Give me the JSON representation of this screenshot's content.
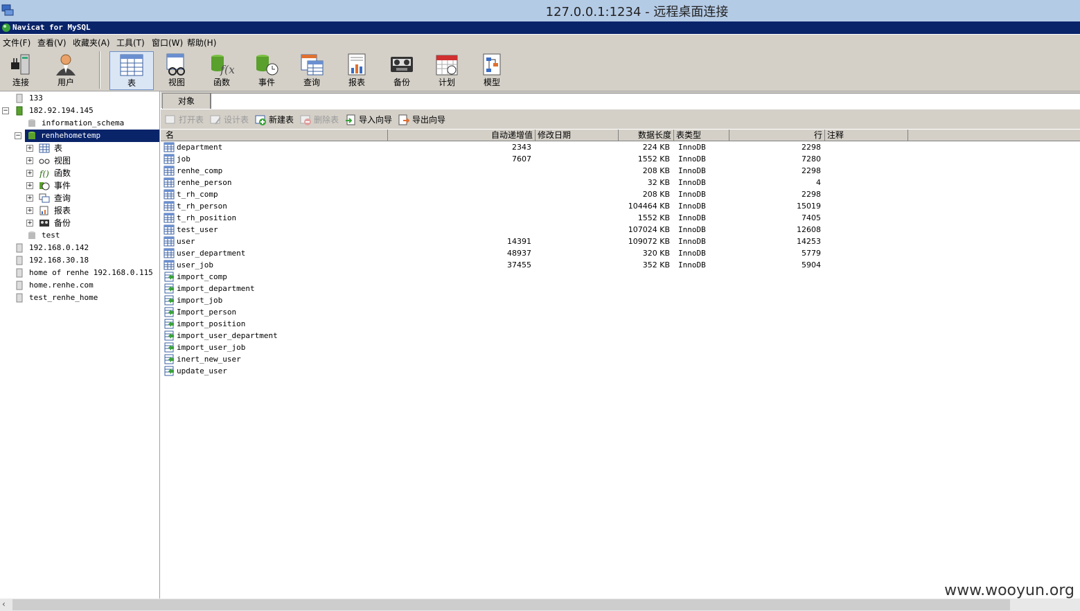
{
  "rdp": {
    "title": "127.0.0.1:1234 - 远程桌面连接"
  },
  "app": {
    "title": "Navicat for MySQL"
  },
  "menu": [
    "文件(F)",
    "查看(V)",
    "收藏夹(A)",
    "工具(T)",
    "窗口(W)",
    "帮助(H)"
  ],
  "toolbar": [
    {
      "label": "连接",
      "icon": "connection-plug-icon"
    },
    {
      "label": "用户",
      "icon": "user-icon"
    },
    {
      "label": "表",
      "icon": "table-icon",
      "active": true
    },
    {
      "label": "视图",
      "icon": "view-icon"
    },
    {
      "label": "函数",
      "icon": "function-icon"
    },
    {
      "label": "事件",
      "icon": "event-icon"
    },
    {
      "label": "查询",
      "icon": "query-icon"
    },
    {
      "label": "报表",
      "icon": "report-icon"
    },
    {
      "label": "备份",
      "icon": "backup-icon"
    },
    {
      "label": "计划",
      "icon": "schedule-icon"
    },
    {
      "label": "模型",
      "icon": "model-icon"
    }
  ],
  "tree": [
    {
      "label": "133"
    },
    {
      "label": "182.92.194.145"
    },
    {
      "label": "information_schema"
    },
    {
      "label": "renhehometemp"
    },
    {
      "label": "表"
    },
    {
      "label": "视图"
    },
    {
      "label": "函数"
    },
    {
      "label": "事件"
    },
    {
      "label": "查询"
    },
    {
      "label": "报表"
    },
    {
      "label": "备份"
    },
    {
      "label": "test"
    },
    {
      "label": "192.168.0.142"
    },
    {
      "label": "192.168.30.18"
    },
    {
      "label": "home of renhe 192.168.0.115"
    },
    {
      "label": "home.renhe.com"
    },
    {
      "label": "test_renhe_home"
    }
  ],
  "tabs": {
    "objects": "对象"
  },
  "obj_toolbar": {
    "open": "打开表",
    "design": "设计表",
    "new": "新建表",
    "delete": "删除表",
    "import": "导入向导",
    "export": "导出向导"
  },
  "columns": {
    "name": "名",
    "auto_inc": "自动递增值",
    "modified": "修改日期",
    "data_len": "数据长度",
    "type": "表类型",
    "rows": "行",
    "comment": "注释"
  },
  "tables": [
    {
      "name": "department",
      "auto_inc": "2343",
      "data_len": "224 KB",
      "type": "InnoDB",
      "rows": "2298"
    },
    {
      "name": "job",
      "auto_inc": "7607",
      "data_len": "1552 KB",
      "type": "InnoDB",
      "rows": "7280"
    },
    {
      "name": "renhe_comp",
      "auto_inc": "",
      "data_len": "208 KB",
      "type": "InnoDB",
      "rows": "2298"
    },
    {
      "name": "renhe_person",
      "auto_inc": "",
      "data_len": "32 KB",
      "type": "InnoDB",
      "rows": "4"
    },
    {
      "name": "t_rh_comp",
      "auto_inc": "",
      "data_len": "208 KB",
      "type": "InnoDB",
      "rows": "2298"
    },
    {
      "name": "t_rh_person",
      "auto_inc": "",
      "data_len": "104464 KB",
      "type": "InnoDB",
      "rows": "15019"
    },
    {
      "name": "t_rh_position",
      "auto_inc": "",
      "data_len": "1552 KB",
      "type": "InnoDB",
      "rows": "7405"
    },
    {
      "name": "test_user",
      "auto_inc": "",
      "data_len": "107024 KB",
      "type": "InnoDB",
      "rows": "12608"
    },
    {
      "name": "user",
      "auto_inc": "14391",
      "data_len": "109072 KB",
      "type": "InnoDB",
      "rows": "14253"
    },
    {
      "name": "user_department",
      "auto_inc": "48937",
      "data_len": "320 KB",
      "type": "InnoDB",
      "rows": "5779"
    },
    {
      "name": "user_job",
      "auto_inc": "37455",
      "data_len": "352 KB",
      "type": "InnoDB",
      "rows": "5904"
    }
  ],
  "imports": [
    "import_comp",
    "import_department",
    "import_job",
    "Import_person",
    "import_position",
    "import_user_department",
    "import_user_job",
    "inert_new_user",
    "update_user"
  ],
  "watermark": "www.wooyun.org",
  "colors": {
    "app_title_bg": "#0a246a",
    "rdp_bar_bg": "#b4cbe6",
    "chrome": "#d4d0c8",
    "selection": "#0a246a"
  }
}
